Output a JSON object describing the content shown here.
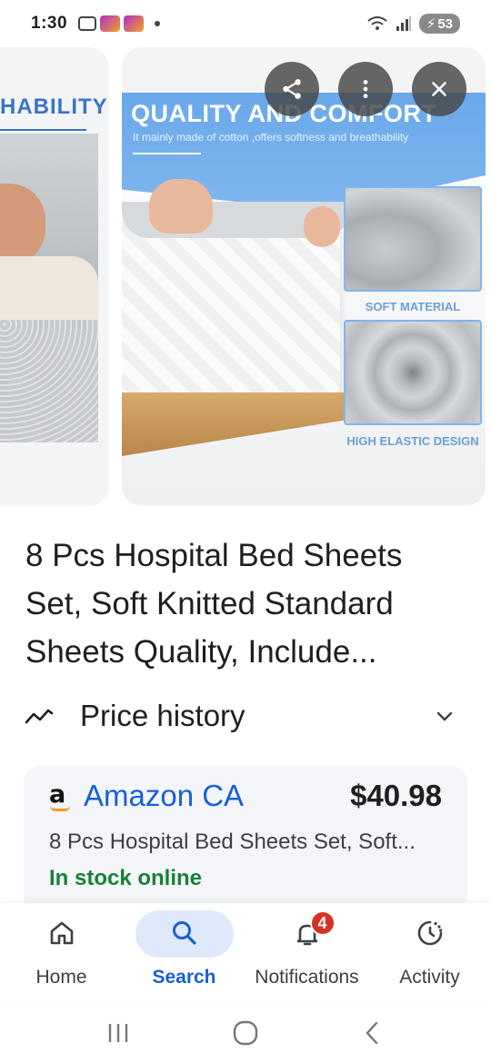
{
  "status_bar": {
    "time": "1:30",
    "battery": "53"
  },
  "carousel": {
    "left_card_text": "HABILITY",
    "main_image": {
      "headline": "QUALITY AND COMFORT",
      "subline": "It mainly made of cotton ,offers softness and breathability",
      "swatch_1_label": "SOFT MATERIAL",
      "swatch_2_label": "HIGH ELASTIC DESIGN"
    },
    "actions": [
      "share-icon",
      "more-vert-icon",
      "close-icon"
    ]
  },
  "product": {
    "title": "8 Pcs Hospital Bed Sheets Set, Soft Knitted Standard Sheets Quality, Include..."
  },
  "price_history": {
    "label": "Price history"
  },
  "offer": {
    "merchant": "Amazon CA",
    "merchant_logo": "a",
    "price": "$40.98",
    "description": "8 Pcs Hospital Bed Sheets Set, Soft...",
    "stock": "In stock online"
  },
  "bottom_nav": {
    "items": [
      {
        "label": "Home",
        "icon": "home-icon"
      },
      {
        "label": "Search",
        "icon": "search-icon"
      },
      {
        "label": "Notifications",
        "icon": "bell-icon",
        "badge": "4"
      },
      {
        "label": "Activity",
        "icon": "activity-icon"
      }
    ],
    "active": "Search"
  },
  "colors": {
    "accent": "#1a5fd6",
    "stock_green": "#188038",
    "badge_red": "#d93025"
  }
}
